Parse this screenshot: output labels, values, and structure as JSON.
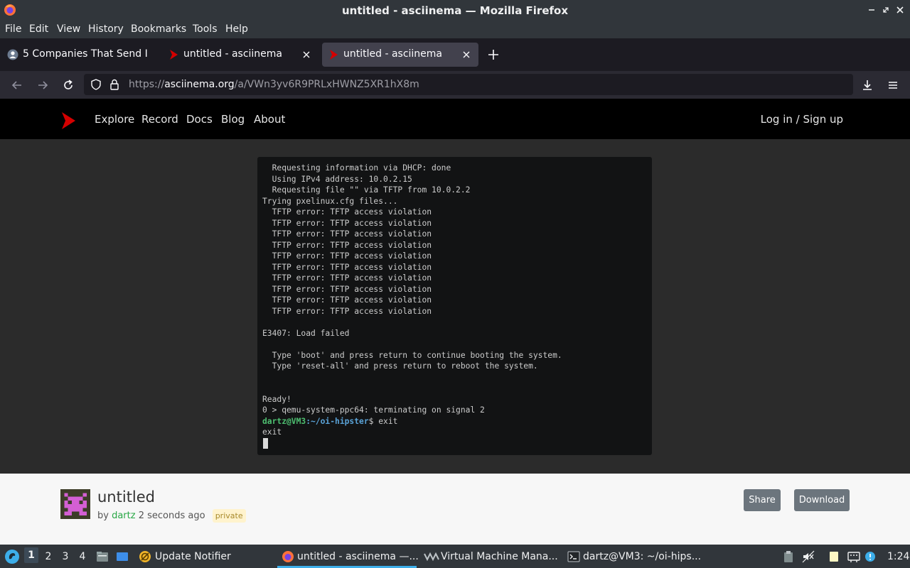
{
  "window": {
    "title": "untitled - asciinema — Mozilla Firefox"
  },
  "menu": [
    "File",
    "Edit",
    "View",
    "History",
    "Bookmarks",
    "Tools",
    "Help"
  ],
  "tabs": [
    {
      "label": "5 Companies That Send I",
      "icon": "user-icon",
      "active": false
    },
    {
      "label": "untitled - asciinema",
      "icon": "asciinema-icon",
      "active": false
    },
    {
      "label": "untitled - asciinema",
      "icon": "asciinema-icon",
      "active": true
    }
  ],
  "urlbar": {
    "scheme": "https://",
    "host": "asciinema.org",
    "path": "/a/VWn3yv6R9PRLxHWNZ5XR1hX8m"
  },
  "site": {
    "nav": [
      "Explore",
      "Record",
      "Docs",
      "Blog",
      "About"
    ],
    "login": "Log in / Sign up"
  },
  "terminal": {
    "lines": [
      "  Requesting information via DHCP: done",
      "  Using IPv4 address: 10.0.2.15",
      "  Requesting file \"\" via TFTP from 10.0.2.2",
      "Trying pxelinux.cfg files...",
      "  TFTP error: TFTP access violation",
      "  TFTP error: TFTP access violation",
      "  TFTP error: TFTP access violation",
      "  TFTP error: TFTP access violation",
      "  TFTP error: TFTP access violation",
      "  TFTP error: TFTP access violation",
      "  TFTP error: TFTP access violation",
      "  TFTP error: TFTP access violation",
      "  TFTP error: TFTP access violation",
      "  TFTP error: TFTP access violation",
      "",
      "E3407: Load failed",
      "",
      "  Type 'boot' and press return to continue booting the system.",
      "  Type 'reset-all' and press return to reboot the system.",
      "",
      "",
      "Ready!",
      "0 > qemu-system-ppc64: terminating on signal 2"
    ],
    "prompt_user": "dartz@VM3",
    "prompt_path": ":~/oi-hipster",
    "prompt_suffix": "$ exit",
    "last_line": "exit"
  },
  "recording": {
    "title": "untitled",
    "by": "by",
    "author": "dartz",
    "time": "2 seconds ago",
    "badge": "private",
    "share": "Share",
    "download": "Download"
  },
  "taskbar": {
    "workspaces": [
      "1",
      "2",
      "3",
      "4"
    ],
    "active_workspace": "1",
    "tasks": [
      {
        "label": "Update Notifier",
        "icon": "update-notifier-icon"
      },
      {
        "label": "untitled - asciinema —...",
        "icon": "firefox-icon",
        "active": true
      },
      {
        "label": "Virtual Machine Mana...",
        "icon": "vm-manager-icon"
      },
      {
        "label": "dartz@VM3: ~/oi-hips...",
        "icon": "terminal-icon"
      }
    ],
    "clock": "1:24"
  },
  "colors": {
    "accent": "#3daee9",
    "brand_red": "#d40000",
    "author_green": "#28a745"
  }
}
